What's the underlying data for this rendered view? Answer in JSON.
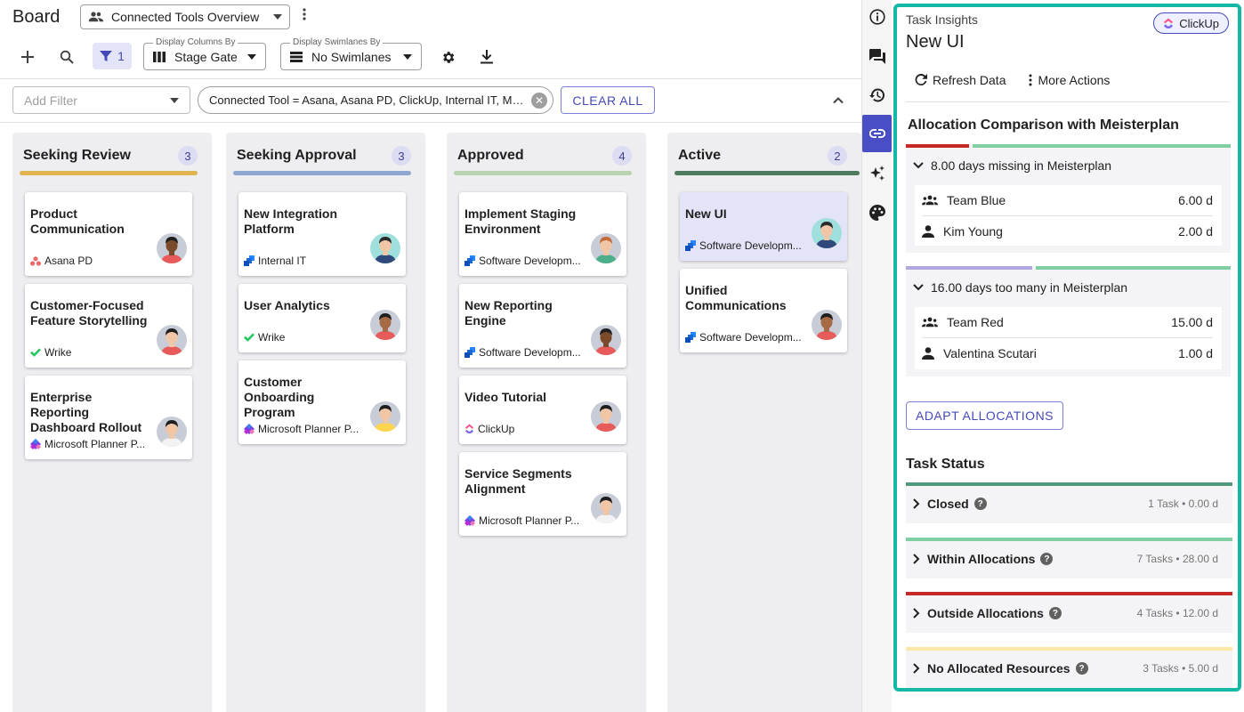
{
  "header": {
    "title": "Board",
    "view_name": "Connected Tools Overview"
  },
  "toolbar": {
    "filter_count": "1",
    "columns_label": "Display Columns By",
    "columns_value": "Stage Gate",
    "swimlanes_label": "Display Swimlanes By",
    "swimlanes_value": "No Swimlanes"
  },
  "filterbar": {
    "add_filter_placeholder": "Add Filter",
    "chip_text": "Connected Tool = Asana, Asana PD, ClickUp, Internal IT, Microsoft Planner",
    "clear_all": "CLEAR ALL"
  },
  "columns": [
    {
      "title": "Seeking Review",
      "count": "3",
      "color": "#e0b44e",
      "cards": [
        {
          "title": "Product Communication",
          "tool": "Asana PD"
        },
        {
          "title": "Customer-Focused Feature Storytelling",
          "tool": "Wrike"
        },
        {
          "title": "Enterprise Reporting Dashboard Rollout",
          "tool": "Microsoft Planner P..."
        }
      ]
    },
    {
      "title": "Seeking Approval",
      "count": "3",
      "color": "#8fa6d0",
      "cards": [
        {
          "title": "New Integration Platform",
          "tool": "Internal IT"
        },
        {
          "title": "User Analytics",
          "tool": "Wrike"
        },
        {
          "title": "Customer Onboarding Program",
          "tool": "Microsoft Planner P..."
        }
      ]
    },
    {
      "title": "Approved",
      "count": "4",
      "color": "#b9d2b0",
      "cards": [
        {
          "title": "Implement Staging Environment",
          "tool": "Software Developm..."
        },
        {
          "title": "New Reporting Engine",
          "tool": "Software Developm..."
        },
        {
          "title": "Video Tutorial",
          "tool": "ClickUp"
        },
        {
          "title": "Service Segments Alignment",
          "tool": "Microsoft Planner P..."
        }
      ]
    },
    {
      "title": "Active",
      "count": "2",
      "color": "#4f7a5e",
      "cards": [
        {
          "title": "New UI",
          "tool": "Software Developm..."
        },
        {
          "title": "Unified Communications",
          "tool": "Software Developm..."
        }
      ]
    }
  ],
  "panel": {
    "label": "Task Insights",
    "title": "New UI",
    "badge": "ClickUp",
    "refresh": "Refresh Data",
    "more": "More Actions",
    "allocation_heading": "Allocation Comparison with Meisterplan",
    "group1": {
      "summary": "8.00 days missing in Meisterplan",
      "rows": [
        {
          "name": "Team Blue",
          "value": "6.00 d"
        },
        {
          "name": "Kim Young",
          "value": "2.00 d"
        }
      ]
    },
    "group2": {
      "summary": "16.00 days too many in Meisterplan",
      "rows": [
        {
          "name": "Team Red",
          "value": "15.00 d"
        },
        {
          "name": "Valentina Scutari",
          "value": "1.00 d"
        }
      ]
    },
    "adapt_button": "ADAPT ALLOCATIONS",
    "status_heading": "Task Status",
    "statuses": [
      {
        "name": "Closed",
        "meta": "1 Task • 0.00 d",
        "color": "#4f9a7c"
      },
      {
        "name": "Within Allocations",
        "meta": "7 Tasks • 28.00 d",
        "color": "#7fcfa3"
      },
      {
        "name": "Outside Allocations",
        "meta": "4 Tasks • 12.00 d",
        "color": "#c62828"
      },
      {
        "name": "No Allocated Resources",
        "meta": "3 Tasks • 5.00 d",
        "color": "#fbe8a6"
      }
    ]
  },
  "colors": {
    "accent": "#4a4ec4",
    "panel_border": "#14b8a6",
    "missing_bar_red": "#c62828",
    "bar_green": "#7fcfa3",
    "bar_purple": "#b0a8e0"
  }
}
